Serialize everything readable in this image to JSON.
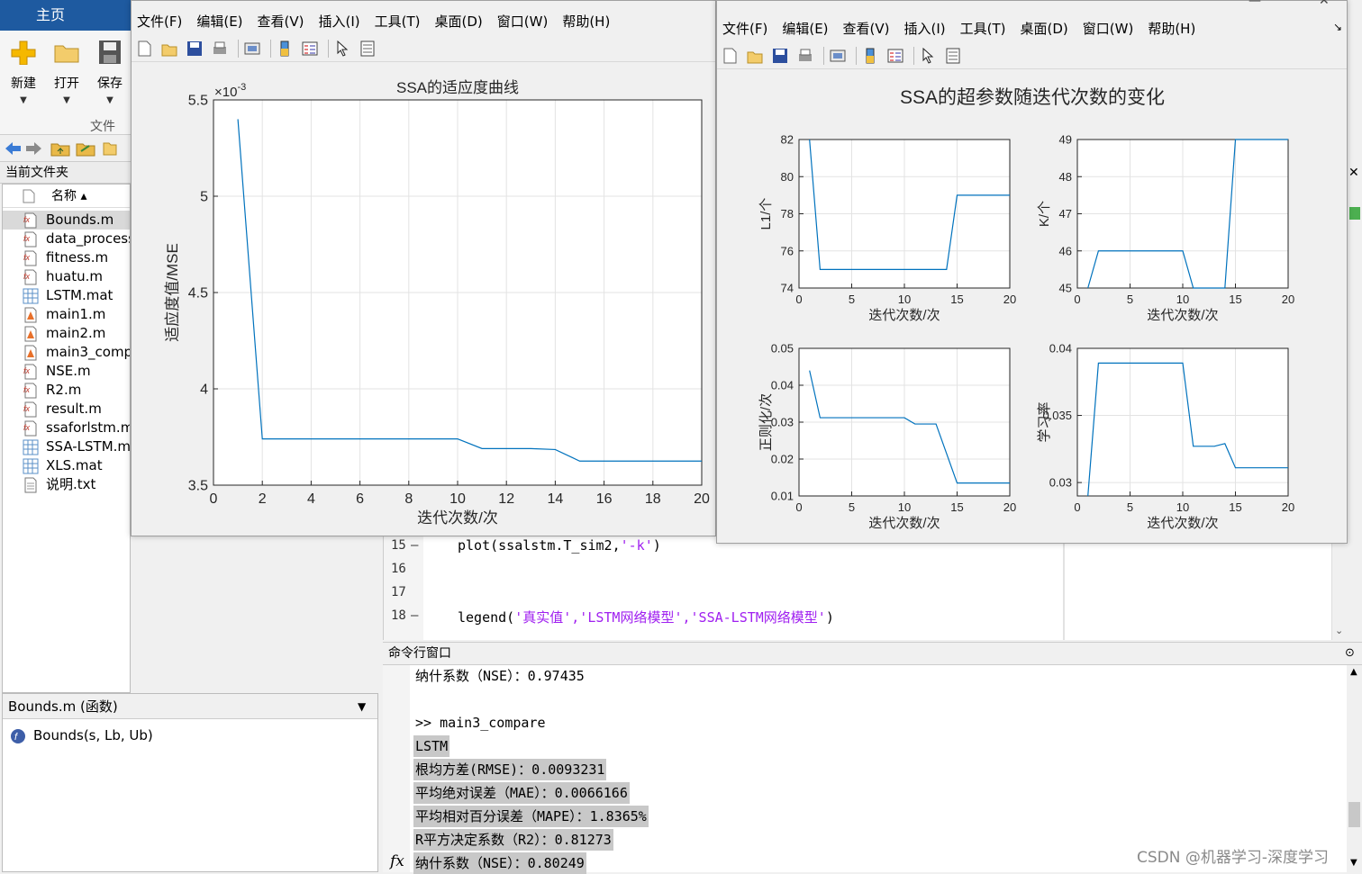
{
  "ribbon": {
    "tab": "主页",
    "new_label": "新建",
    "open_label": "打开",
    "save_label": "保存",
    "group_label": "文件"
  },
  "current_folder": {
    "title": "当前文件夹",
    "column_header": "名称 ▴",
    "files": [
      {
        "name": "Bounds.m",
        "type": "fn",
        "selected": true
      },
      {
        "name": "data_process",
        "type": "fn"
      },
      {
        "name": "fitness.m",
        "type": "fn"
      },
      {
        "name": "huatu.m",
        "type": "fn"
      },
      {
        "name": "LSTM.mat",
        "type": "mat"
      },
      {
        "name": "main1.m",
        "type": "script"
      },
      {
        "name": "main2.m",
        "type": "script"
      },
      {
        "name": "main3_comp",
        "type": "script"
      },
      {
        "name": "NSE.m",
        "type": "fn"
      },
      {
        "name": "R2.m",
        "type": "fn"
      },
      {
        "name": "result.m",
        "type": "fn"
      },
      {
        "name": "ssaforlstm.m",
        "type": "fn"
      },
      {
        "name": "SSA-LSTM.m",
        "type": "mat"
      },
      {
        "name": "XLS.mat",
        "type": "mat"
      },
      {
        "name": "说明.txt",
        "type": "txt"
      }
    ]
  },
  "details": {
    "title": "Bounds.m  (函数)",
    "signature": "Bounds(s, Lb, Ub)"
  },
  "editor": {
    "lines": [
      {
        "num": "15",
        "dash": "—",
        "code_pre": "plot(ssalstm.T_sim2,",
        "code_str": "'-k'",
        "code_post": ")"
      },
      {
        "num": "16",
        "dash": "",
        "code_pre": "",
        "code_str": "",
        "code_post": ""
      },
      {
        "num": "17",
        "dash": "",
        "code_pre": "",
        "code_str": "",
        "code_post": ""
      },
      {
        "num": "18",
        "dash": "—",
        "code_pre": "legend(",
        "code_str": "'真实值','LSTM网络模型','SSA-LSTM网络模型'",
        "code_post": ")"
      }
    ]
  },
  "command_window": {
    "title": "命令行窗口",
    "lines": [
      {
        "text": "纳什系数（NSE）：0.97435",
        "hl": false
      },
      {
        "text": "",
        "hl": false
      },
      {
        "text": ">> main3_compare",
        "hl": false
      },
      {
        "text": "LSTM",
        "hl": true
      },
      {
        "text": "根均方差(RMSE)：0.0093231",
        "hl": true
      },
      {
        "text": "平均绝对误差（MAE）：0.0066166",
        "hl": true
      },
      {
        "text": "平均相对百分误差（MAPE）：1.8365%",
        "hl": true
      },
      {
        "text": "R平方决定系数（R2）：0.81273",
        "hl": true
      },
      {
        "text": "纳什系数（NSE）：0.80249",
        "hl": true
      }
    ],
    "prompt_icon": "fx"
  },
  "watermark": "CSDN @机器学习-深度学习",
  "menu": [
    "文件(F)",
    "编辑(E)",
    "查看(V)",
    "插入(I)",
    "工具(T)",
    "桌面(D)",
    "窗口(W)",
    "帮助(H)"
  ],
  "menu_keys": [
    "F",
    "E",
    "V",
    "I",
    "T",
    "D",
    "W",
    "H"
  ],
  "colors": {
    "line": "#0072bd",
    "ribbon": "#1e5aa0",
    "highlight": "#c8c8c8"
  },
  "chart_data": [
    {
      "type": "line",
      "title": "SSA的适应度曲线",
      "xlabel": "迭代次数/次",
      "ylabel": "适应度值/MSE",
      "exponent_label": "×10",
      "exponent": "-3",
      "xlim": [
        0,
        20
      ],
      "ylim": [
        3.5,
        5.5
      ],
      "xticks": [
        0,
        2,
        4,
        6,
        8,
        10,
        12,
        14,
        16,
        18,
        20
      ],
      "yticks": [
        3.5,
        4,
        4.5,
        5,
        5.5
      ],
      "grid": true,
      "x": [
        1,
        2,
        3,
        4,
        5,
        6,
        7,
        8,
        9,
        10,
        11,
        12,
        13,
        14,
        15,
        16,
        17,
        18,
        19,
        20
      ],
      "y": [
        5.4,
        3.74,
        3.74,
        3.74,
        3.74,
        3.74,
        3.74,
        3.74,
        3.74,
        3.74,
        3.69,
        3.69,
        3.69,
        3.685,
        3.625,
        3.625,
        3.625,
        3.625,
        3.625,
        3.625
      ]
    },
    {
      "type": "line",
      "title": "SSA的超参数随迭代次数的变化",
      "subplots": [
        {
          "xlabel": "迭代次数/次",
          "ylabel": "L1/个",
          "xlim": [
            0,
            20
          ],
          "ylim": [
            74,
            82
          ],
          "xticks": [
            0,
            5,
            10,
            15,
            20
          ],
          "yticks": [
            74,
            76,
            78,
            80,
            82
          ],
          "x": [
            1,
            2,
            3,
            4,
            5,
            6,
            7,
            8,
            9,
            10,
            11,
            12,
            13,
            14,
            15,
            16,
            17,
            18,
            19,
            20
          ],
          "y": [
            82,
            75,
            75,
            75,
            75,
            75,
            75,
            75,
            75,
            75,
            75,
            75,
            75,
            75,
            79,
            79,
            79,
            79,
            79,
            79
          ]
        },
        {
          "xlabel": "迭代次数/次",
          "ylabel": "K/个",
          "xlim": [
            0,
            20
          ],
          "ylim": [
            45,
            49
          ],
          "xticks": [
            0,
            5,
            10,
            15,
            20
          ],
          "yticks": [
            45,
            46,
            47,
            48,
            49
          ],
          "x": [
            1,
            2,
            3,
            4,
            5,
            6,
            7,
            8,
            9,
            10,
            11,
            12,
            13,
            14,
            15,
            16,
            17,
            18,
            19,
            20
          ],
          "y": [
            45,
            46,
            46,
            46,
            46,
            46,
            46,
            46,
            46,
            46,
            45,
            45,
            45,
            45,
            49,
            49,
            49,
            49,
            49,
            49
          ]
        },
        {
          "xlabel": "迭代次数/次",
          "ylabel": "正则化/次",
          "xlim": [
            0,
            20
          ],
          "ylim": [
            0.01,
            0.05
          ],
          "xticks": [
            0,
            5,
            10,
            15,
            20
          ],
          "yticks": [
            0.01,
            0.02,
            0.03,
            0.04,
            0.05
          ],
          "x": [
            1,
            2,
            3,
            4,
            5,
            6,
            7,
            8,
            9,
            10,
            11,
            12,
            13,
            14,
            15,
            16,
            17,
            18,
            19,
            20
          ],
          "y": [
            0.044,
            0.0312,
            0.0312,
            0.0312,
            0.0312,
            0.0312,
            0.0312,
            0.0312,
            0.0312,
            0.0312,
            0.0295,
            0.0295,
            0.0295,
            0.0215,
            0.0135,
            0.0135,
            0.0135,
            0.0135,
            0.0135,
            0.0135
          ]
        },
        {
          "xlabel": "迭代次数/次",
          "ylabel": "学习率",
          "xlim": [
            0,
            20
          ],
          "ylim": [
            0.029,
            0.04
          ],
          "xticks": [
            0,
            5,
            10,
            15,
            20
          ],
          "yticks": [
            0.03,
            0.035,
            0.04
          ],
          "x": [
            1,
            2,
            3,
            4,
            5,
            6,
            7,
            8,
            9,
            10,
            11,
            12,
            13,
            14,
            15,
            16,
            17,
            18,
            19,
            20
          ],
          "y": [
            0.029,
            0.0389,
            0.0389,
            0.0389,
            0.0389,
            0.0389,
            0.0389,
            0.0389,
            0.0389,
            0.0389,
            0.0327,
            0.0327,
            0.0327,
            0.0329,
            0.0311,
            0.0311,
            0.0311,
            0.0311,
            0.0311,
            0.0311
          ]
        }
      ]
    }
  ]
}
